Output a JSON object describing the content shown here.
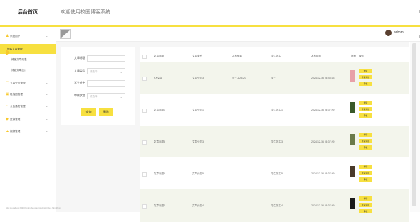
{
  "header": {
    "brand": "后台首页",
    "welcome": "欢迎使用校园博客系统",
    "user": "admin"
  },
  "sidebar": {
    "items": [
      {
        "label": "系统用户",
        "icon": "user-icon",
        "type": "group"
      },
      {
        "label": "博客文章管理",
        "type": "active"
      },
      {
        "label": "博客文章列表",
        "type": "sub"
      },
      {
        "label": "博客文章统计",
        "type": "sub"
      },
      {
        "label": "文章分类管理",
        "icon": "folder-icon",
        "type": "group"
      },
      {
        "label": "轮播图管理",
        "icon": "image-icon",
        "type": "group"
      },
      {
        "label": "公告通知管理",
        "icon": "bell-icon",
        "type": "group"
      },
      {
        "label": "资源管理",
        "icon": "pin-icon",
        "type": "group"
      },
      {
        "label": "视频管理",
        "icon": "video-icon",
        "type": "group"
      }
    ]
  },
  "search": {
    "fields": [
      {
        "label": "文章标题",
        "placeholder": "",
        "dropdown": false
      },
      {
        "label": "文章类型",
        "placeholder": "请选择",
        "dropdown": true
      },
      {
        "label": "学生姓名",
        "placeholder": "",
        "dropdown": false
      },
      {
        "label": "审核状态",
        "placeholder": "请选择",
        "dropdown": true
      }
    ],
    "query_label": "查询",
    "delete_label": "删除"
  },
  "table": {
    "columns": [
      "文章标题",
      "文章类型",
      "发布作者",
      "学生姓名",
      "发布时间",
      "封面",
      "操作"
    ],
    "rows": [
      {
        "title": "XX文章",
        "type": "文章分类3",
        "author": "张三-123123",
        "student": "张三",
        "time": "2024-12-16 08:45:33",
        "thumb": "#e8a0a8"
      },
      {
        "title": "文章标题1",
        "type": "文章分类1",
        "author": "",
        "student": "学生姓名1",
        "time": "2024-12-16 08:37:29",
        "thumb": "#3a5a2a"
      },
      {
        "title": "文章标题3",
        "type": "文章分类3",
        "author": "",
        "student": "学生姓名3",
        "time": "2024-12-16 08:37:29",
        "thumb": "#6a7a4a"
      },
      {
        "title": "文章标题5",
        "type": "文章分类5",
        "author": "",
        "student": "学生姓名5",
        "time": "2024-12-16 08:37:29",
        "thumb": "#4a3a2a"
      },
      {
        "title": "文章标题4",
        "type": "文章分类4",
        "author": "",
        "student": "学生姓名4",
        "time": "2024-12-16 08:37:29",
        "thumb": "#1a1a1a"
      }
    ],
    "actions": [
      "详情",
      "查看评论",
      "审核"
    ]
  },
  "status_url": "http://localhost:8080/springboot/admin/dist/index.html#/xxx"
}
